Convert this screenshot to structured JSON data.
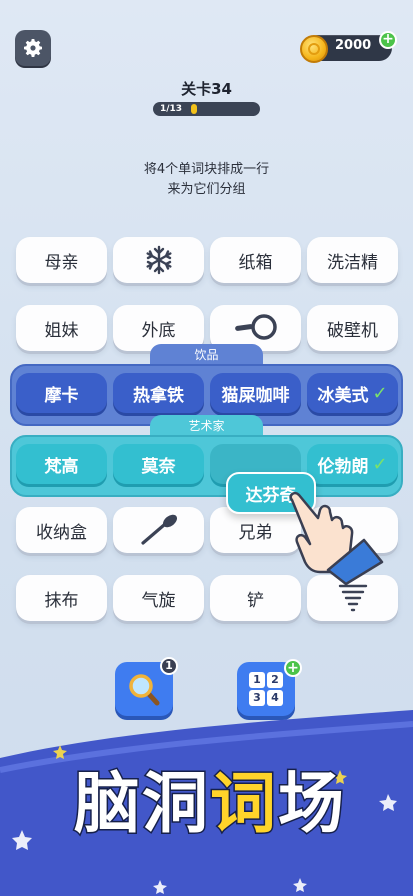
{
  "header": {
    "coins": "2000",
    "level_title": "关卡34",
    "progress_label": "1/13",
    "progress": 0.077
  },
  "instructions": [
    "将4个单词块排成一行",
    "来为它们分组"
  ],
  "tiles": {
    "row1": [
      "母亲",
      "snowflake",
      "纸箱",
      "洗洁精"
    ],
    "row2": [
      "姐妹",
      "外底",
      "frying-pan",
      "破壁机"
    ],
    "row6": [
      "收纳盒",
      "spoon",
      "兄弟",
      ""
    ],
    "row7": [
      "抹布",
      "气旋",
      "铲",
      "tornado"
    ]
  },
  "groups": {
    "drinks": {
      "label": "饮品",
      "items": [
        "摩卡",
        "热拿铁",
        "猫屎咖啡",
        "冰美式"
      ]
    },
    "artists": {
      "label": "艺术家",
      "items": [
        "梵高",
        "莫奈",
        "",
        "伦勃朗"
      ]
    }
  },
  "dragging_tile": "达芬奇",
  "boosters": {
    "hint_count": "1",
    "hint_icon": "magnifier-icon",
    "shuffle_digits": [
      "1",
      "2",
      "3",
      "4"
    ],
    "shuffle_badge": "+"
  },
  "banner": {
    "chars": [
      "脑",
      "洞",
      "词",
      "场"
    ]
  },
  "colors": {
    "accent_blue": "#3a5fc9",
    "accent_teal": "#33bfd0",
    "coin_gold": "#f5b51a",
    "progress_yellow": "#f3c21a",
    "banner_blue": "#4257c9"
  }
}
